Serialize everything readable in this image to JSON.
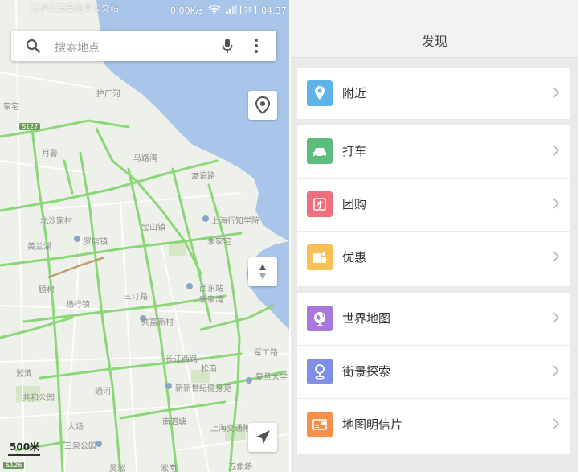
{
  "map_screen": {
    "status_bar": {
      "notice": "石沪公安局渔中公交站",
      "speed": "0.00K/s",
      "battery": "35",
      "time": "04:37"
    },
    "search": {
      "placeholder": "搜索地点"
    },
    "scale": "500米",
    "labels": {
      "l1": "护厂河",
      "l2": "家宅",
      "l3": "S127",
      "l4": "月馨",
      "l5": "马路湾",
      "l6": "友谊路",
      "l7": "北沙家村",
      "l8": "上海行知学院",
      "l9": "罗店镇",
      "l10": "宝山镇",
      "l11": "朱家宅",
      "l12": "美兰湖",
      "l13": "顾村",
      "l14": "西东站",
      "l15": "宋家湾",
      "l16": "杨行镇",
      "l17": "三汀路",
      "l18": "共富新村",
      "l19": "长江西路",
      "l20": "松南",
      "l21": "军工路",
      "l22": "复旦大学",
      "l23": "淞滨",
      "l24": "共和公园",
      "l25": "通河",
      "l26": "新新世纪健身苑",
      "l27": "大场",
      "l28": "南泗塘",
      "l29": "三泉公园",
      "l30": "上海交通附中",
      "l31": "五角场",
      "l32": "S126",
      "l33": "吴淞",
      "l34": "淞南"
    }
  },
  "discover_screen": {
    "title": "发现",
    "groups": [
      {
        "items": [
          {
            "label": "附近",
            "icon": "location-pin-icon",
            "color": "#5fb3e8"
          }
        ]
      },
      {
        "items": [
          {
            "label": "打车",
            "icon": "car-icon",
            "color": "#5cbd7e"
          },
          {
            "label": "团购",
            "icon": "group-buy-icon",
            "color": "#ee6e7c"
          },
          {
            "label": "优惠",
            "icon": "coupon-icon",
            "color": "#f6c057"
          }
        ]
      },
      {
        "items": [
          {
            "label": "世界地图",
            "icon": "globe-icon",
            "color": "#a878dc"
          },
          {
            "label": "街景探索",
            "icon": "street-view-icon",
            "color": "#7f8fe6"
          },
          {
            "label": "地图明信片",
            "icon": "postcard-icon",
            "color": "#f4904a"
          }
        ]
      }
    ]
  },
  "colors": {
    "water": "#a9c6ea",
    "land": "#eef0ea",
    "roads": "#8cd67a"
  }
}
